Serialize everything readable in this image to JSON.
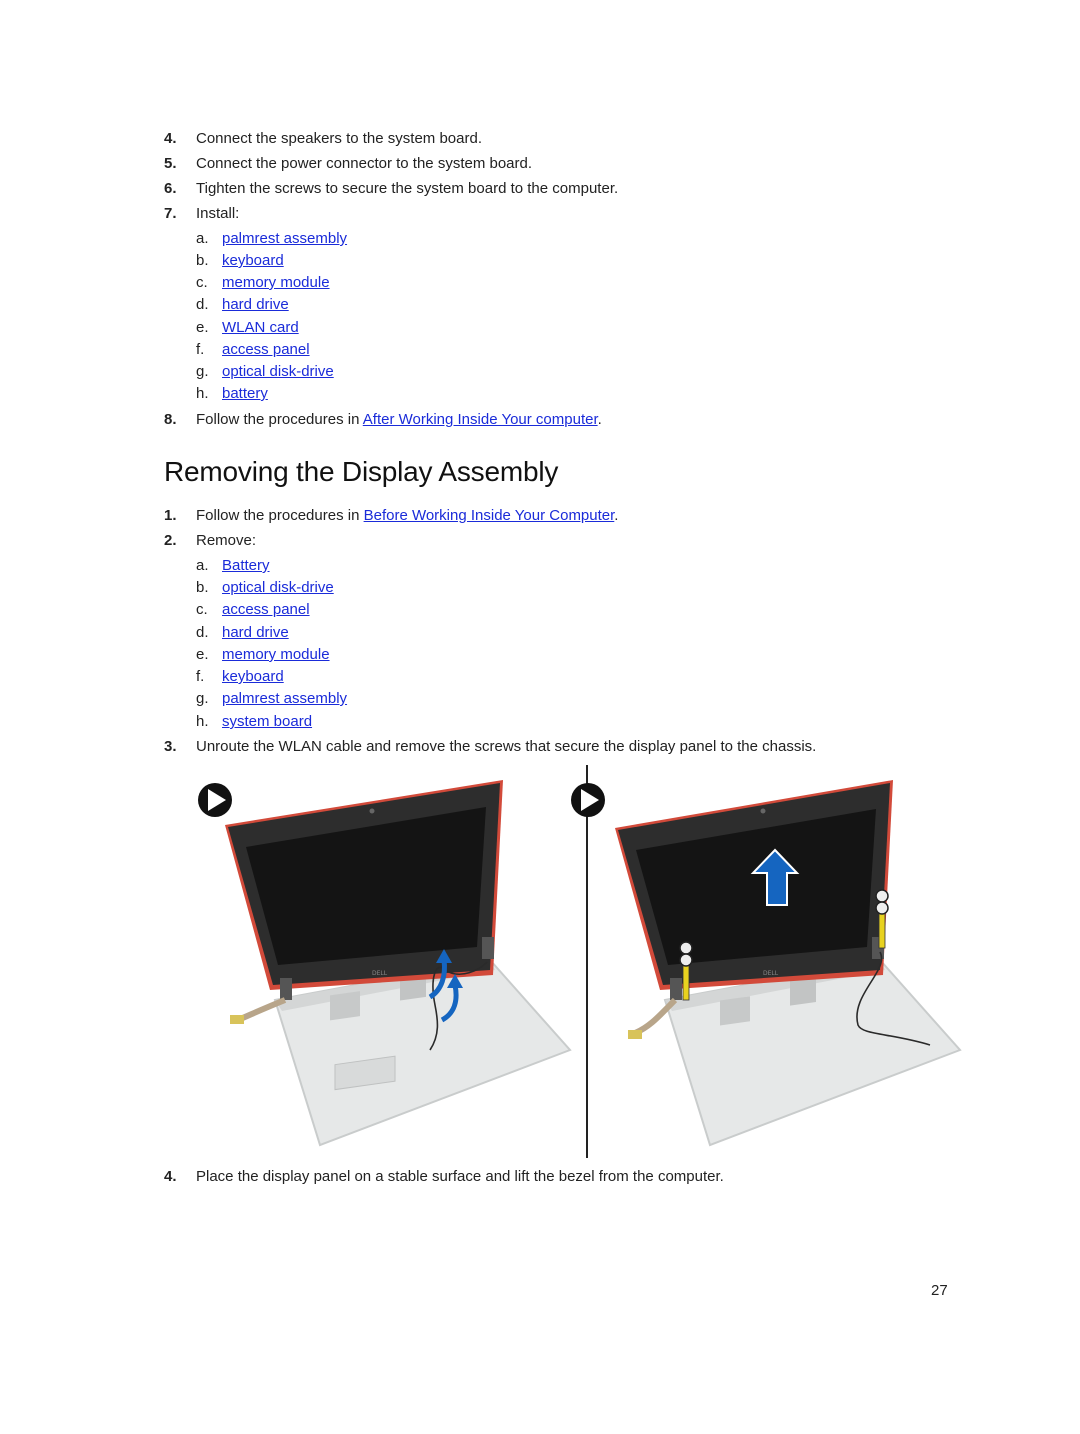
{
  "top_steps": [
    {
      "num": "4.",
      "text": "Connect the speakers to the system board."
    },
    {
      "num": "5.",
      "text": "Connect the power connector to the system board."
    },
    {
      "num": "6.",
      "text": "Tighten the screws to secure the system board to the computer."
    },
    {
      "num": "7.",
      "text": "Install:"
    }
  ],
  "install_items": [
    {
      "letter": "a.",
      "link": "palmrest assembly"
    },
    {
      "letter": "b.",
      "link": "keyboard"
    },
    {
      "letter": "c.",
      "link": "memory module"
    },
    {
      "letter": "d.",
      "link": "hard drive"
    },
    {
      "letter": "e.",
      "link": "WLAN card"
    },
    {
      "letter": "f.",
      "link": "access panel"
    },
    {
      "letter": "g.",
      "link": "optical disk-drive"
    },
    {
      "letter": "h.",
      "link": "battery"
    }
  ],
  "step8": {
    "num": "8.",
    "prefix": "Follow the procedures in ",
    "link": "After Working Inside Your computer",
    "suffix": "."
  },
  "section_title": "Removing the Display Assembly",
  "section_steps": {
    "step1": {
      "num": "1.",
      "prefix": "Follow the procedures in ",
      "link": "Before Working Inside Your Computer",
      "suffix": "."
    },
    "step2": {
      "num": "2.",
      "text": "Remove:"
    },
    "remove_items": [
      {
        "letter": "a.",
        "link": "Battery"
      },
      {
        "letter": "b.",
        "link": "optical disk-drive"
      },
      {
        "letter": "c.",
        "link": "access panel"
      },
      {
        "letter": "d.",
        "link": "hard drive"
      },
      {
        "letter": "e.",
        "link": "memory module"
      },
      {
        "letter": "f.",
        "link": "keyboard"
      },
      {
        "letter": "g.",
        "link": "palmrest assembly"
      },
      {
        "letter": "h.",
        "link": "system board"
      }
    ],
    "step3": {
      "num": "3.",
      "text": "Unroute the WLAN cable and remove the screws that secure the display panel to the chassis."
    },
    "step4": {
      "num": "4.",
      "text": "Place the display panel on a stable surface and lift the bezel from the computer."
    }
  },
  "figure": {
    "panels": [
      "unroute-wlan-cable",
      "remove-display-screws"
    ],
    "colors": {
      "arrow": "#1565c0",
      "bezel": "#c0392b",
      "screen": "#151515",
      "chassis": "#e4e6e6",
      "screw_callout": "#e8d21f"
    }
  },
  "page_number": "27"
}
